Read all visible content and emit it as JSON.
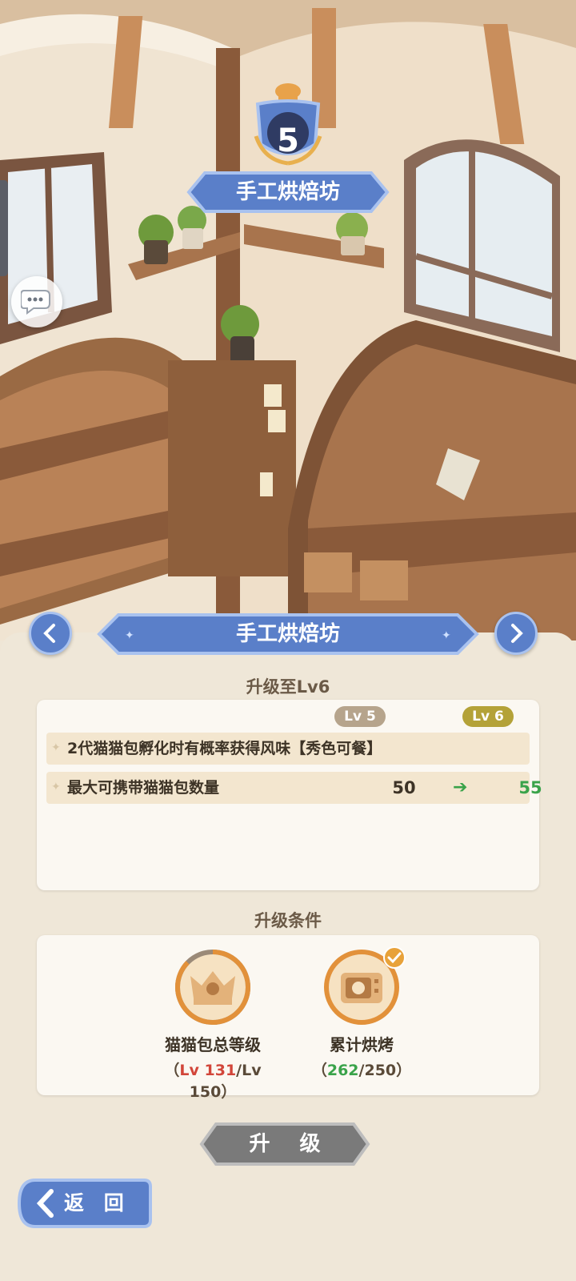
{
  "building": {
    "level": "5",
    "name_top": "手工烘焙坊",
    "name_main": "手工烘焙坊"
  },
  "upgrade": {
    "title": "升级至Lv6",
    "current_level": "Lv 5",
    "next_level": "Lv 6",
    "effects": [
      {
        "text": "2代猫猫包孵化时有概率获得风味【秀色可餐】"
      },
      {
        "text": "最大可携带猫猫包数量",
        "old": "50",
        "arrow": "➔",
        "new": "55"
      }
    ]
  },
  "conditions": {
    "title": "升级条件",
    "items": [
      {
        "name": "猫猫包总等级",
        "prog_open": "（",
        "current": "Lv 131",
        "sep": "/Lv 150",
        "prog_close": "）",
        "status": "unmet",
        "progress": 0.873
      },
      {
        "name": "累计烘烤",
        "prog_open": "（",
        "current": "262",
        "sep": "/250",
        "prog_close": "）",
        "status": "met",
        "progress": 1.0
      }
    ]
  },
  "buttons": {
    "upgrade": "升 级",
    "back": "返 回"
  },
  "colors": {
    "accent_blue": "#5a7fc9",
    "progress_unmet": "#d2463a",
    "progress_met": "#3aa34a",
    "ring": "#e2913a"
  }
}
